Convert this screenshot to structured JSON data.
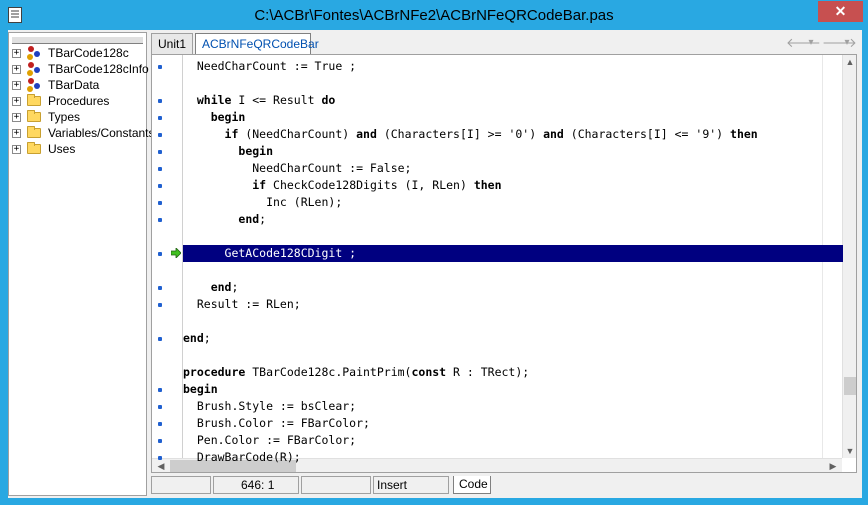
{
  "window": {
    "title": "C:\\ACBr\\Fontes\\ACBrNFe2\\ACBrNFeQRCodeBar.pas",
    "close_glyph": "✕"
  },
  "explorer": {
    "items": [
      {
        "label": "TBarCode128c",
        "icon": "class-icon"
      },
      {
        "label": "TBarCode128cInfo",
        "icon": "class-icon"
      },
      {
        "label": "TBarData",
        "icon": "class-icon"
      },
      {
        "label": "Procedures",
        "icon": "folder-icon"
      },
      {
        "label": "Types",
        "icon": "folder-icon"
      },
      {
        "label": "Variables/Constants",
        "icon": "folder-icon"
      },
      {
        "label": "Uses",
        "icon": "folder-icon"
      }
    ],
    "expand_glyph": "+"
  },
  "tabs": [
    {
      "label": "Unit1"
    },
    {
      "label": "ACBrNFeQRCodeBar"
    }
  ],
  "nav": {
    "back": "🡐",
    "dropdown": "▾",
    "forward": "🡒"
  },
  "code": [
    {
      "text": "  NeedCharCount := True ;",
      "bp": true
    },
    {
      "text": "",
      "bp": false
    },
    {
      "text": "  while I <= Result do",
      "bp": true
    },
    {
      "text": "    begin",
      "bp": true
    },
    {
      "text": "      if (NeedCharCount) and (Characters[I] >= '0') and (Characters[I] <= '9') then",
      "bp": true
    },
    {
      "text": "        begin",
      "bp": true
    },
    {
      "text": "          NeedCharCount := False;",
      "bp": true
    },
    {
      "text": "          if CheckCode128Digits (I, RLen) then",
      "bp": true
    },
    {
      "text": "            Inc (RLen);",
      "bp": true
    },
    {
      "text": "        end;",
      "bp": true
    },
    {
      "text": "",
      "bp": false
    },
    {
      "text": "      GetACode128CDigit ;",
      "bp": true,
      "highlight": true
    },
    {
      "text": "",
      "bp": false
    },
    {
      "text": "    end;",
      "bp": true
    },
    {
      "text": "  Result := RLen;",
      "bp": true
    },
    {
      "text": "",
      "bp": false
    },
    {
      "text": "end;",
      "bp": true
    },
    {
      "text": "",
      "bp": false
    },
    {
      "text": "procedure TBarCode128c.PaintPrim(const R : TRect);",
      "bp": false
    },
    {
      "text": "begin",
      "bp": true
    },
    {
      "text": "  Brush.Style := bsClear;",
      "bp": true
    },
    {
      "text": "  Brush.Color := FBarColor;",
      "bp": true
    },
    {
      "text": "  Pen.Color := FBarColor;",
      "bp": true
    },
    {
      "text": "  DrawBarCode(R);",
      "bp": true
    }
  ],
  "status": {
    "position": "646:  1",
    "modified": "",
    "mode": "Insert",
    "view_tab": "Code"
  },
  "colors": {
    "titlebar": "#29a8e2",
    "highlight": "#000080",
    "breakpoint": "#2060d0",
    "close": "#c75050"
  }
}
